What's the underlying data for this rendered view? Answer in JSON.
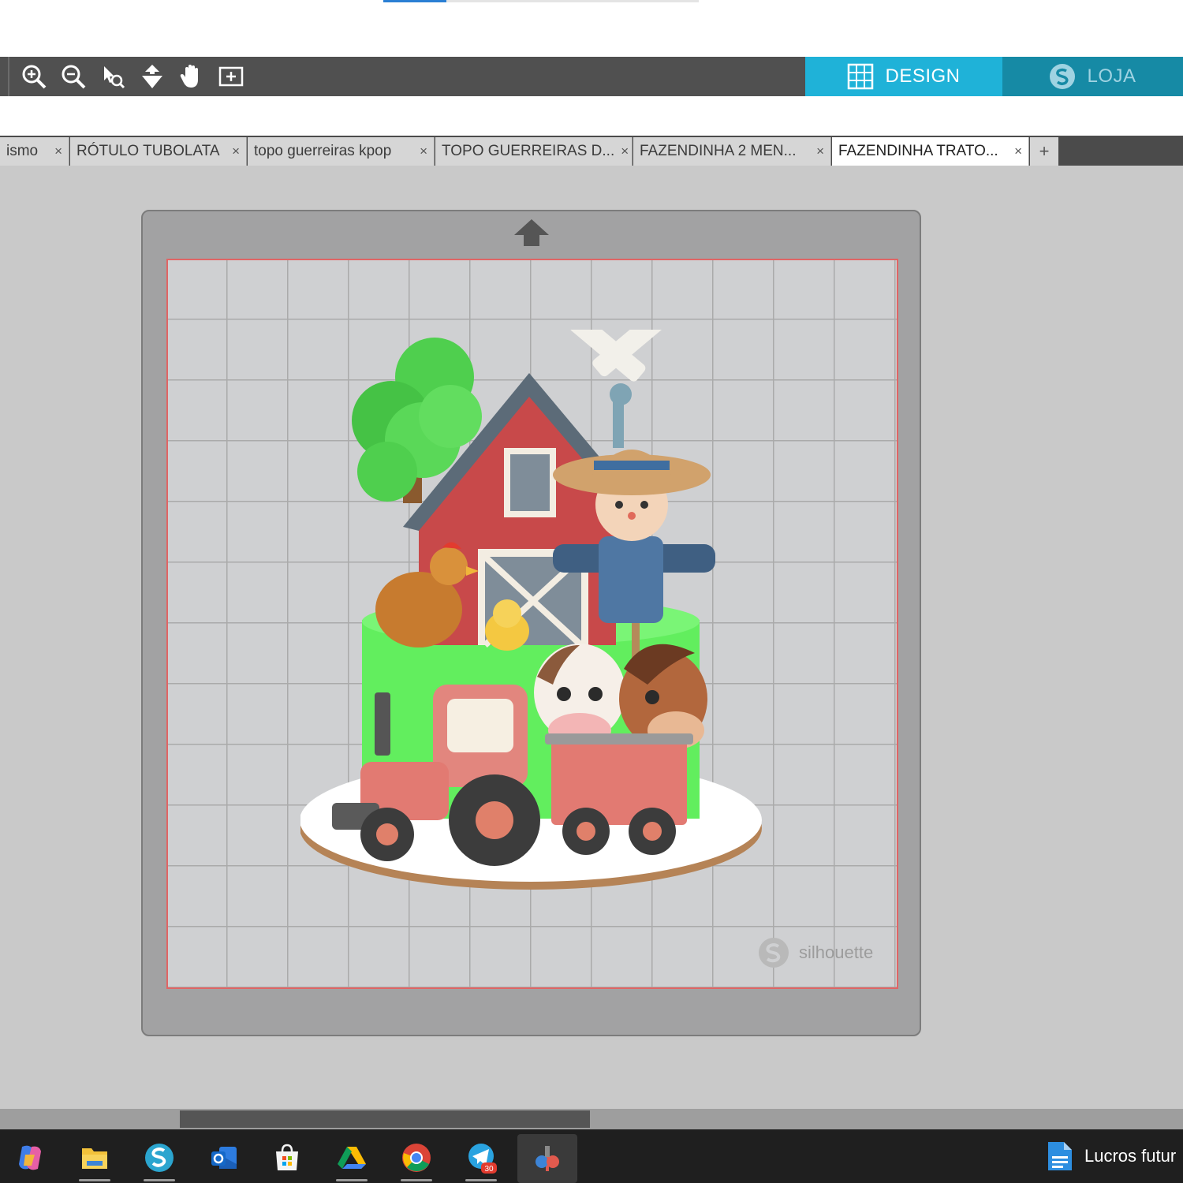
{
  "top_progress": {
    "percent": 20
  },
  "toolbar": {
    "tools": [
      {
        "icon": "zoom-in-icon"
      },
      {
        "icon": "zoom-out-icon"
      },
      {
        "icon": "zoom-select-icon"
      },
      {
        "icon": "pan-down-icon"
      },
      {
        "icon": "hand-icon"
      },
      {
        "icon": "fit-to-page-icon"
      }
    ],
    "design_label": "DESIGN",
    "store_label": "LOJA",
    "colors": {
      "bar": "#505050",
      "design": "#1fb2d8",
      "store": "#168aa5"
    }
  },
  "tabs": [
    {
      "label": "ismo",
      "close": "×"
    },
    {
      "label": "RÓTULO TUBOLATA",
      "close": "×"
    },
    {
      "label": "topo guerreiras kpop",
      "close": "×"
    },
    {
      "label": "TOPO GUERREIRAS D...",
      "close": "×"
    },
    {
      "label": "FAZENDINHA 2 MEN...",
      "close": "×"
    },
    {
      "label": "FAZENDINHA TRATO...",
      "close": "×",
      "active": true
    }
  ],
  "add_tab": "+",
  "canvas": {
    "mat_colors": {
      "mat": "#a2a2a3",
      "grid": "#cfd0d2",
      "cut_border": "#e06565"
    },
    "artwork_elements": [
      "tree",
      "barn",
      "windmill",
      "scarecrow",
      "hen",
      "chick",
      "green-cake-tier",
      "cow",
      "horse",
      "tractor",
      "trailer",
      "white-cake-base"
    ],
    "watermark": "silhouette"
  },
  "taskbar": {
    "apps": [
      {
        "icon": "copilot-icon"
      },
      {
        "icon": "file-explorer-icon",
        "running": true
      },
      {
        "icon": "silhouette-studio-icon",
        "running": true
      },
      {
        "icon": "outlook-icon"
      },
      {
        "icon": "microsoft-store-icon"
      },
      {
        "icon": "google-drive-icon",
        "running": true
      },
      {
        "icon": "chrome-icon",
        "running": true
      },
      {
        "icon": "telegram-icon",
        "badge": "30",
        "running": true
      },
      {
        "icon": "cutting-app-icon",
        "active": true
      }
    ],
    "open_file": "Lucros futur"
  }
}
